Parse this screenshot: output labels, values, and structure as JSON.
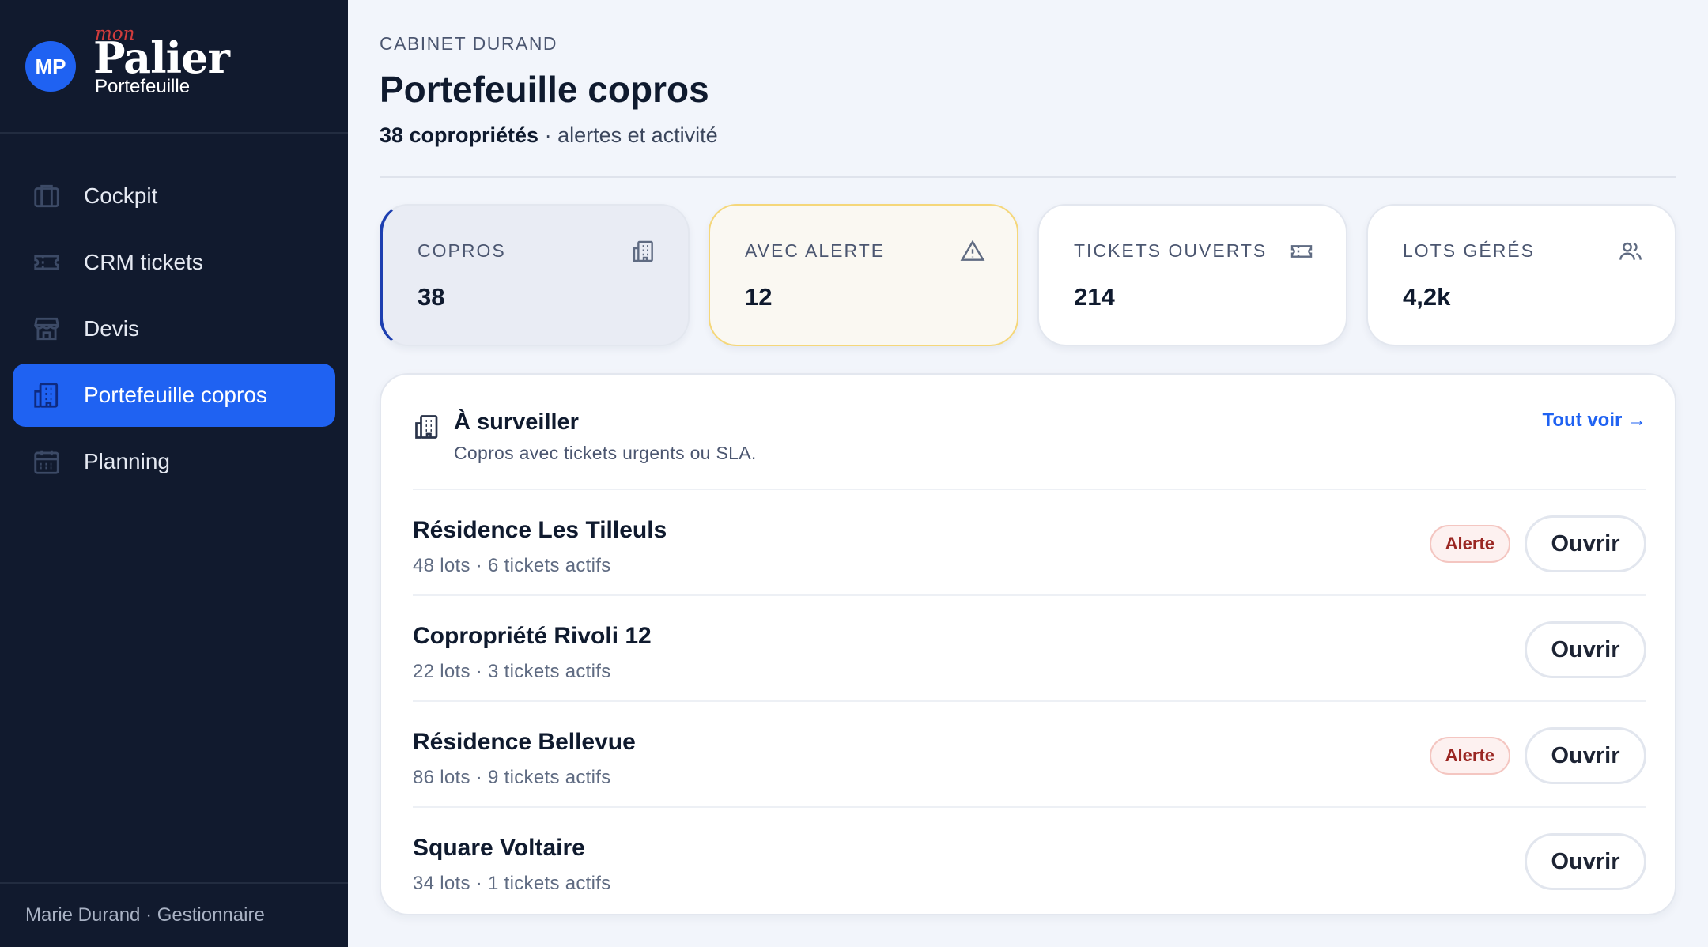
{
  "brand": {
    "avatar": "MP",
    "prefix": "mon",
    "name": "Palier",
    "subtitle": "Portefeuille"
  },
  "sidebar": {
    "items": [
      {
        "label": "Cockpit",
        "icon": "briefcase-icon",
        "active": false
      },
      {
        "label": "CRM tickets",
        "icon": "ticket-icon",
        "active": false
      },
      {
        "label": "Devis",
        "icon": "store-icon",
        "active": false
      },
      {
        "label": "Portefeuille copros",
        "icon": "building-icon",
        "active": true
      },
      {
        "label": "Planning",
        "icon": "calendar-icon",
        "active": false
      }
    ],
    "footer": "Marie Durand · Gestionnaire"
  },
  "header": {
    "eyebrow": "CABINET DURAND",
    "title": "Portefeuille copros",
    "count": "38 copropriétés",
    "subtitle_rest": " · alertes et activité"
  },
  "stats": [
    {
      "label": "COPROS",
      "value": "38",
      "icon": "building-icon"
    },
    {
      "label": "AVEC ALERTE",
      "value": "12",
      "icon": "warning-icon"
    },
    {
      "label": "TICKETS OUVERTS",
      "value": "214",
      "icon": "ticket-icon"
    },
    {
      "label": "LOTS GÉRÉS",
      "value": "4,2k",
      "icon": "users-icon"
    }
  ],
  "panel": {
    "title": "À surveiller",
    "subtitle": "Copros avec tickets urgents ou SLA.",
    "see_all": "Tout voir →",
    "rows": [
      {
        "name": "Résidence Les Tilleuls",
        "meta": "48 lots · 6 tickets actifs",
        "badge": "Alerte",
        "action": "Ouvrir"
      },
      {
        "name": "Copropriété Rivoli 12",
        "meta": "22 lots · 3 tickets actifs",
        "badge": "",
        "action": "Ouvrir"
      },
      {
        "name": "Résidence Bellevue",
        "meta": "86 lots · 9 tickets actifs",
        "badge": "Alerte",
        "action": "Ouvrir"
      },
      {
        "name": "Square Voltaire",
        "meta": "34 lots · 1 tickets actifs",
        "badge": "",
        "action": "Ouvrir"
      }
    ]
  },
  "colors": {
    "sidebar_bg": "#111a2e",
    "accent": "#1f62f2",
    "alert_border": "#f5d77a",
    "badge_text": "#9a2622"
  }
}
